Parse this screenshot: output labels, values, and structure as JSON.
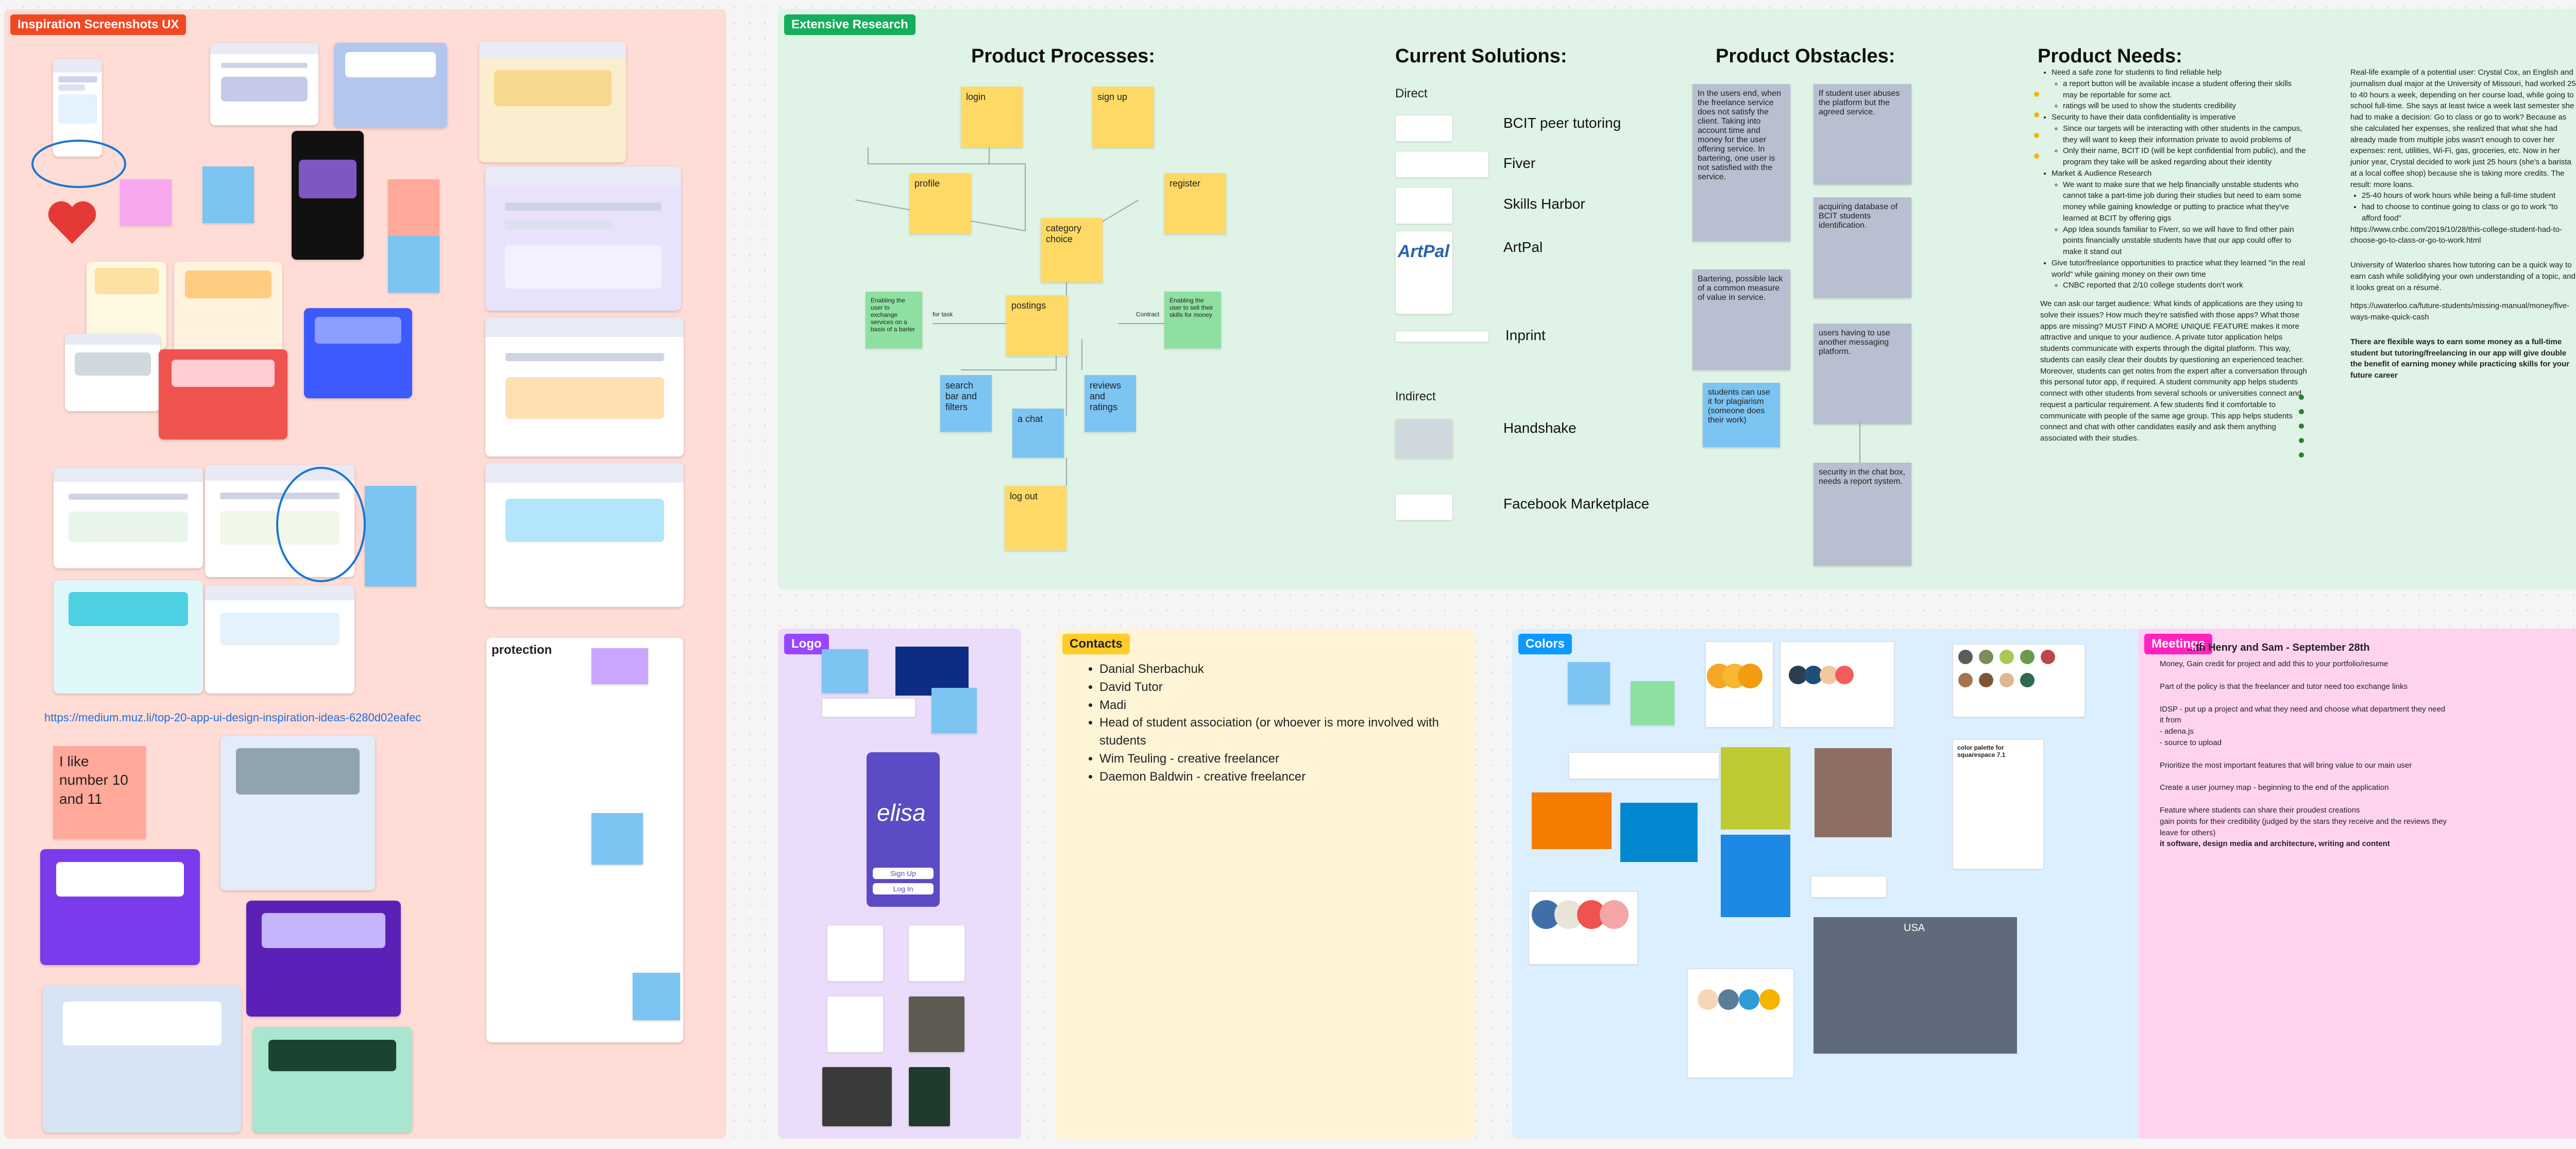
{
  "colors": {
    "inspiration_bg": "#ffdcd6",
    "research_bg": "#dff3e6",
    "logo_bg": "#ebdcfb",
    "contacts_bg": "#fff4d6",
    "colors_bg": "#dcefff",
    "meetings_bg": "#ffd3f0",
    "inspiration_tag": "#f24822",
    "research_tag": "#14ae5c",
    "logo_tag": "#9747ff",
    "contacts_tag": "#ffcd29",
    "colors_tag": "#0d99ff",
    "meetings_tag": "#ff24bd"
  },
  "inspiration": {
    "label": "Inspiration Screenshots UX",
    "link": "https://medium.muz.li/top-20-app-ui-design-inspiration-ideas-6280d02eafec",
    "sticky_like": "I like number 10 and 11",
    "protection_label": "protection",
    "heart_icon": "heart-icon"
  },
  "research": {
    "label": "Extensive Research",
    "processes_title": "Product Processes:",
    "solutions_title": "Current Solutions:",
    "obstacles_title": "Product Obstacles:",
    "needs_title": "Product Needs:",
    "flow": {
      "login": "login",
      "signup": "sign up",
      "profile": "profile",
      "register": "register",
      "category": "category choice",
      "postings": "postings",
      "search": "search bar and filters",
      "reviews": "reviews and ratings",
      "chat": "a chat",
      "logout": "log out",
      "for_task": "for task",
      "contract": "Contract",
      "enabling_left": "Enabling the user to exchange services on a basis of a barter",
      "enabling_right": "Enabling the user to sell their skills for money"
    },
    "direct_label": "Direct",
    "indirect_label": "Indirect",
    "solutions": [
      "BCIT peer tutoring",
      "Fiver",
      "Skills Harbor",
      "ArtPal",
      "Inprint",
      "Handshake",
      "Facebook Marketplace"
    ],
    "artpal_logo": "ArtPal",
    "obstacles_left": [
      "In the users end, when the freelance service does not satisfy the client. Taking into account time and money for the user offering service. In bartering, one user is not satisfied with the service.",
      "Bartering, possible lack of a common measure of value in service.",
      "students can use it for plagiarism (someone does their work)"
    ],
    "obstacles_right": [
      "If student user abuses the platform but the agreed service.",
      "acquiring database of BCIT students identification.",
      "users having to use another messaging platform.",
      "security in the chat box, needs a report system."
    ],
    "needs_items": [
      "Need a safe zone for students to find reliable help",
      "a report button will be available incase a student offering their skills may be reportable for some act.",
      "ratings will be used to show the students credibility",
      "Security to have their data confidentiality is imperative",
      "Since our targets will be interacting with other students in the campus, they will want to keep their information private to avoid problems of",
      "Only their name, BCIT ID (will be kept confidential from public), and the program they take will be asked regarding about their identity",
      "Market & Audience Research",
      "We want to make sure that we help financially unstable students who cannot take a part-time job during their studies but need to earn some money while gaining knowledge or putting to practice what they've learned at BCIT by offering gigs",
      "App Idea sounds familiar to Fiverr, so we will have to find other pain points financially unstable students have that our app could offer to make it stand out",
      "Give tutor/freelance opportunities to practice what they learned \"in the real world\" while gaining money on their own time",
      "CNBC reported that 2/10 college students don't work"
    ],
    "needs_paragraph": "We can ask our target audience: What kinds of applications are they using to solve their issues? How much they're satisfied with those apps? What those apps are missing? MUST FIND A MORE UNIQUE FEATURE makes it more attractive and unique to your audience. A private tutor application helps students communicate with experts through the digital platform. This way, students can easily clear their doubts by questioning an experienced teacher. Moreover, students can get notes from the expert after a conversation through this personal tutor app, if required. A student community app helps students connect with other students from several schools or universities connect and request a particular requirement. A few students find it comfortable to communicate with people of the same age group. This app helps students connect and chat with other candidates easily and ask them anything associated with their studies.",
    "example_text": "Real-life example of a potential user: Crystal Cox, an English and journalism dual major at the University of Missouri, had worked 25 to 40 hours a week, depending on her course load, while going to school full-time. She says at least twice a week last semester she had to make a decision: Go to class or go to work? Because as she calculated her expenses, she realized that what she had already made from multiple jobs wasn't enough to cover her expenses: rent, utilities, Wi-Fi, gas, groceries, etc. Now in her junior year, Crystal decided to work just 25 hours (she's a barista at a local coffee shop) because she is taking more credits. The result: more loans.",
    "example_bullets": [
      "25-40 hours of work hours while being a full-time student",
      "had to choose to continue going to class or go to work \"to afford food\""
    ],
    "example_link": "https://www.cnbc.com/2019/10/28/this-college-student-had-to-choose-go-to-class-or-go-to-work.html",
    "waterloo_text": "University of Waterloo shares how tutoring can be a quick way to earn cash while solidifying your own understanding of a topic, and it looks great on a résumé.",
    "waterloo_link": "https://uwaterloo.ca/future-students/missing-manual/money/five-ways-make-quick-cash",
    "bold_text": "There are flexible ways to earn some money as a full-time student but tutoring/freelancing in our app will give double the benefit of earning money while practicing skills for your future career"
  },
  "logo": {
    "label": "Logo",
    "elisa_text": "elisa",
    "sign_up": "Sign Up",
    "log_in": "Log In"
  },
  "contacts": {
    "label": "Contacts",
    "items": [
      "Danial Sherbachuk",
      "David Tutor",
      "Madi",
      "Head of student association (or whoever is more involved with students",
      "Wim Teuling - creative freelancer",
      "Daemon Baldwin - creative freelancer"
    ]
  },
  "colors_section": {
    "label": "Colors",
    "palette_title": "color palette for squarespace 7.1",
    "usa_label": "USA",
    "swatch_colors": [
      "#f5a623",
      "#f7b731",
      "#f39c12",
      "#2c3e50",
      "#1f4e79",
      "#f4c7a1",
      "#f45b5b",
      "#3e6fa8",
      "#e8e4d8",
      "#ef5350",
      "#f4a6a6",
      "#f6d6b8",
      "#5b7c99",
      "#2e9cd8",
      "#f4b400",
      "#5b5b5b",
      "#7b8d5b",
      "#a7c957",
      "#6a994e",
      "#bc4749",
      "#a47551",
      "#7f5539",
      "#ddb892",
      "#2d6a4f"
    ]
  },
  "meetings": {
    "label": "Meetings",
    "title": "...th Henry and Sam - September 28th",
    "lines": [
      "Money, Gain credit for project and add this to your portfolio/resume",
      "Part of the policy is that the freelancer and tutor need too exchange links",
      "IDSP - put up a project and what they need and choose what department they need it from",
      "- adena.js",
      "- source to upload",
      "Prioritize the most important features that will bring value to our main user",
      "Create a user journey map - beginning to the end of the application",
      "Feature where students can share their proudest creations",
      "gain points for their credibility (judged by the stars they receive and the reviews they leave for others)"
    ],
    "bold_line": "it software, design media and architecture, writing and content"
  }
}
